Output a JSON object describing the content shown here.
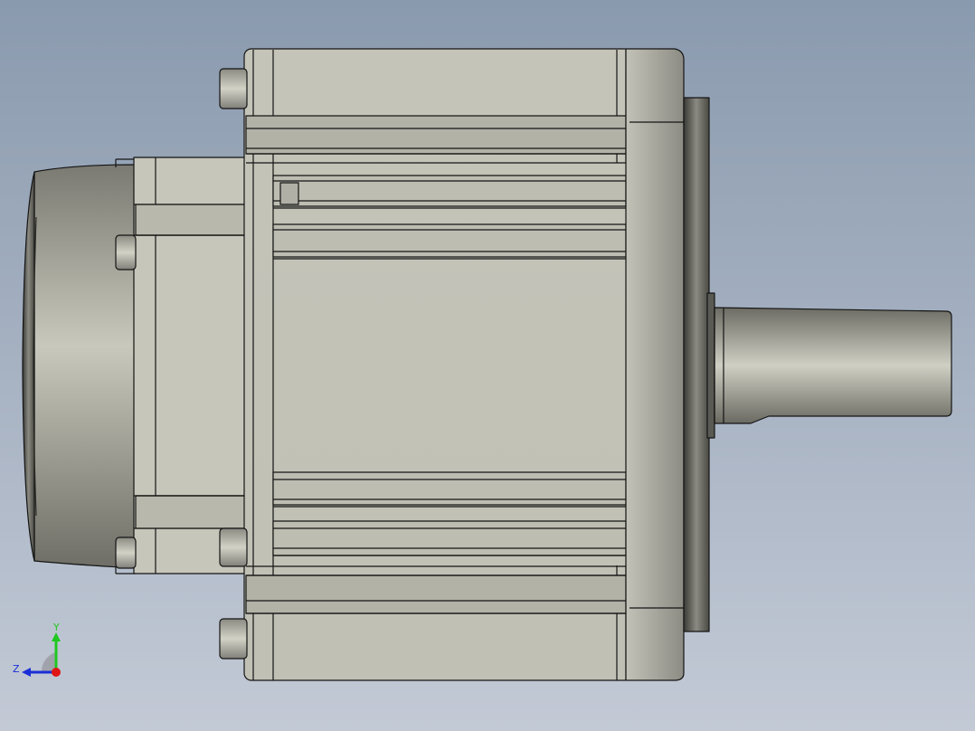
{
  "viewport": {
    "background_top": "#8a9aae",
    "background_bottom": "#c3cad6"
  },
  "model": {
    "body_color": "#c9c9bf",
    "edge_color": "#141414"
  },
  "triad": {
    "y_label": "Y",
    "z_label": "Z",
    "y_color": "#1ec81e",
    "z_color": "#1a2fd6",
    "x_color": "#e01515"
  }
}
